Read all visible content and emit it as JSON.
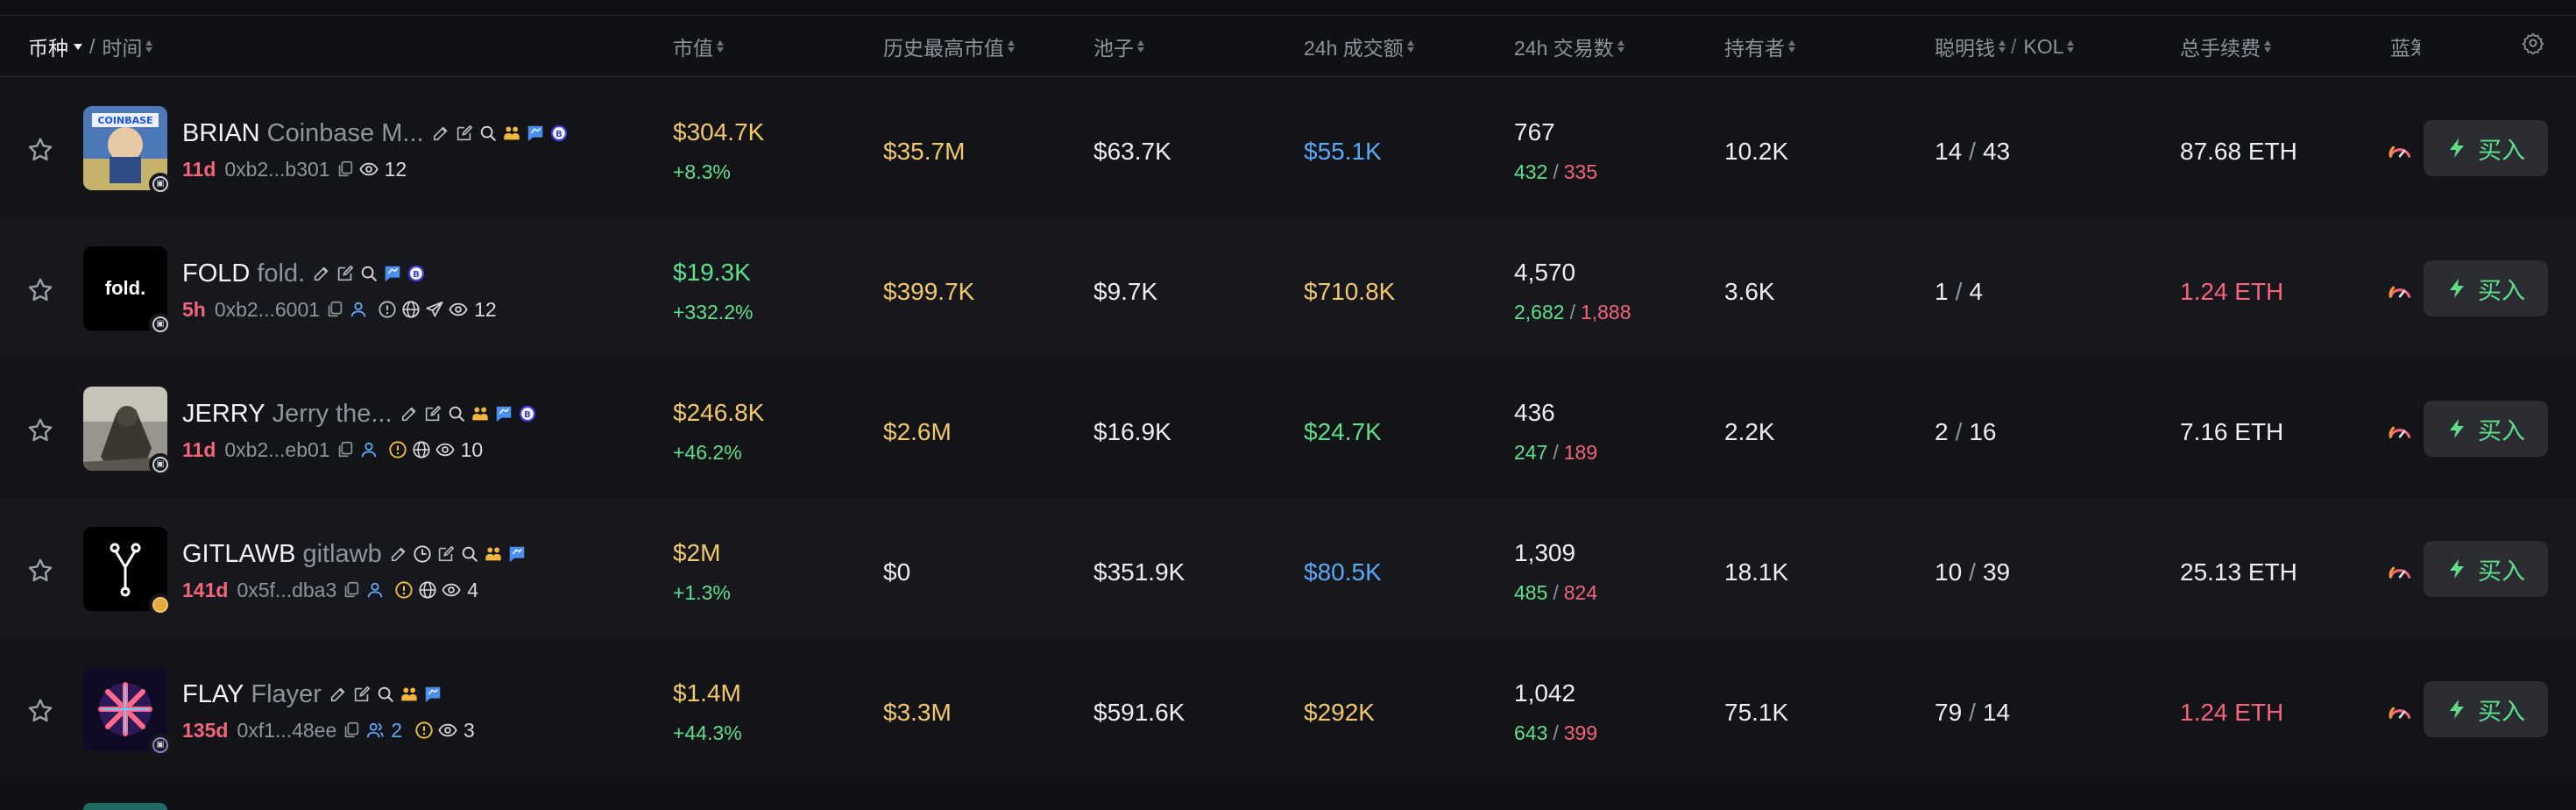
{
  "header": {
    "coin_label": "币种",
    "time_label": "时间",
    "columns": {
      "market_cap": "市值",
      "ath_mcap": "历史最高市值",
      "pool": "池子",
      "vol24": "24h 成交额",
      "tx24": "24h 交易数",
      "holders": "持有者",
      "smart": "聪明钱",
      "kol": "KOL",
      "fees": "总手续费",
      "bluechip": "蓝筹"
    },
    "slash": "/",
    "settings_icon": "gear-icon"
  },
  "colors": {
    "background": "#101114",
    "green": "#5ee08a",
    "red": "#f2657a",
    "yellow": "#f3c86a",
    "blue": "#5aa9f7",
    "muted": "#8f939b"
  },
  "buy_label": "买入",
  "rows": [
    {
      "symbol": "BRIAN",
      "name": "Coinbase M...",
      "age": "11d",
      "address": "0xb2...b301",
      "views": "12",
      "market_cap": "$304.7K",
      "mcap_change": "+8.3%",
      "ath": "$35.7M",
      "pool": "$63.7K",
      "volume": "$55.1K",
      "tx_total": "767",
      "tx_buys": "432",
      "tx_sells": "335",
      "holders": "10.2K",
      "smart": "14",
      "kol": "43",
      "fees": "87.68 ETH",
      "avatar_text": "COINBASE"
    },
    {
      "symbol": "FOLD",
      "name": "fold.",
      "age": "5h",
      "address": "0xb2...6001",
      "views": "12",
      "market_cap": "$19.3K",
      "mcap_change": "+332.2%",
      "ath": "$399.7K",
      "pool": "$9.7K",
      "volume": "$710.8K",
      "tx_total": "4,570",
      "tx_buys": "2,682",
      "tx_sells": "1,888",
      "holders": "3.6K",
      "smart": "1",
      "kol": "4",
      "fees": "1.24 ETH",
      "avatar_text": "fold."
    },
    {
      "symbol": "JERRY",
      "name": "Jerry the...",
      "age": "11d",
      "address": "0xb2...eb01",
      "views": "10",
      "market_cap": "$246.8K",
      "mcap_change": "+46.2%",
      "ath": "$2.6M",
      "pool": "$16.9K",
      "volume": "$24.7K",
      "tx_total": "436",
      "tx_buys": "247",
      "tx_sells": "189",
      "holders": "2.2K",
      "smart": "2",
      "kol": "16",
      "fees": "7.16 ETH"
    },
    {
      "symbol": "GITLAWB",
      "name": "gitlawb",
      "age": "141d",
      "address": "0x5f...dba3",
      "views": "4",
      "market_cap": "$2M",
      "mcap_change": "+1.3%",
      "ath": "$0",
      "pool": "$351.9K",
      "volume": "$80.5K",
      "tx_total": "1,309",
      "tx_buys": "485",
      "tx_sells": "824",
      "holders": "18.1K",
      "smart": "10",
      "kol": "39",
      "fees": "25.13 ETH"
    },
    {
      "symbol": "FLAY",
      "name": "Flayer",
      "age": "135d",
      "address": "0xf1...48ee",
      "views": "3",
      "holder_count": "2",
      "market_cap": "$1.4M",
      "mcap_change": "+44.3%",
      "ath": "$3.3M",
      "pool": "$591.6K",
      "volume": "$292K",
      "tx_total": "1,042",
      "tx_buys": "643",
      "tx_sells": "399",
      "holders": "75.1K",
      "smart": "79",
      "kol": "14",
      "fees": "1.24 ETH"
    }
  ]
}
